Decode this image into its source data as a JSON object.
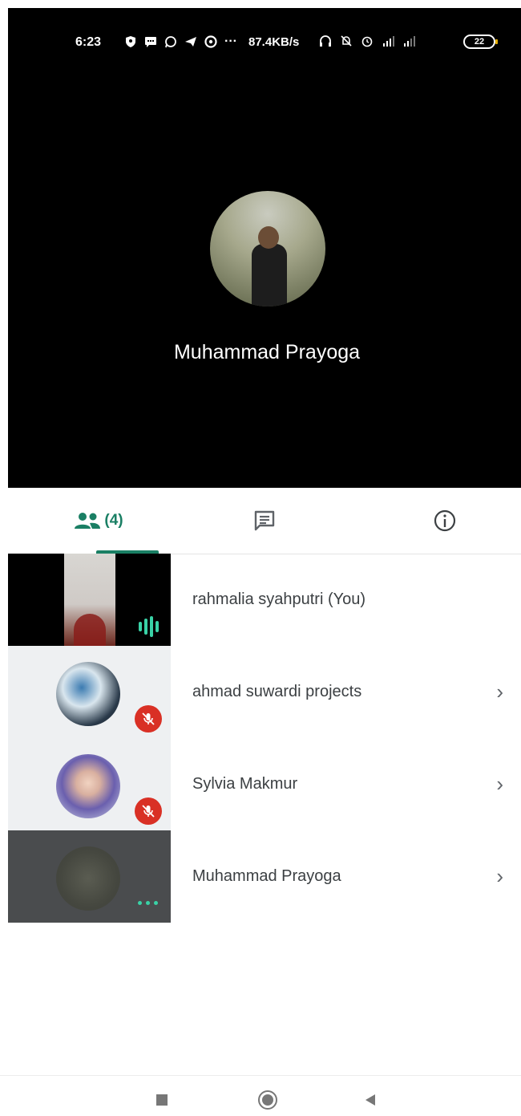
{
  "status_bar": {
    "time": "6:23",
    "network_speed": "87.4KB/s",
    "battery": "22",
    "icons": [
      "vpn-shield-icon",
      "message-icon",
      "whatsapp-icon",
      "telegram-icon",
      "chrome-icon",
      "more-notifications-icon",
      "headset-icon",
      "silent-bell-icon",
      "alarm-icon",
      "signal-1-icon",
      "signal-2-icon"
    ]
  },
  "active_speaker": {
    "name": "Muhammad Prayoga"
  },
  "tabs": {
    "people_count": "(4)",
    "active": "people"
  },
  "participants": [
    {
      "name": "rahmalia syahputri (You)",
      "state": "speaking",
      "has_chevron": false
    },
    {
      "name": "ahmad suwardi projects",
      "state": "muted",
      "has_chevron": true
    },
    {
      "name": "Sylvia Makmur",
      "state": "muted",
      "has_chevron": true
    },
    {
      "name": "Muhammad Prayoga",
      "state": "connecting",
      "has_chevron": true
    }
  ],
  "colors": {
    "accent": "#1a7f64",
    "mute_red": "#d93025",
    "audio_green": "#39d2a6"
  },
  "chevron": "›"
}
